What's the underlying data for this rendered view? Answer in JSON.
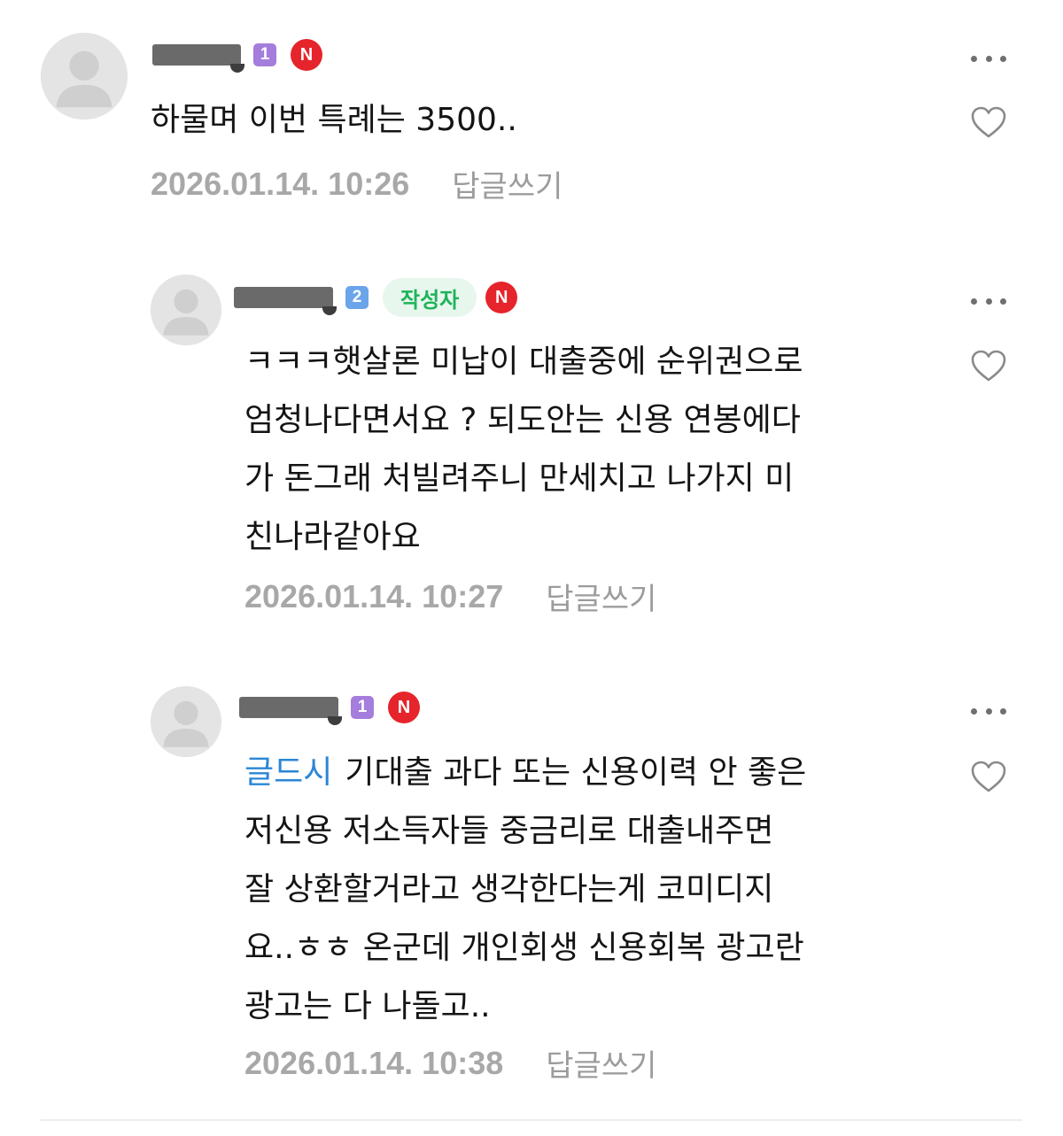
{
  "comments": [
    {
      "level": "1",
      "level_color": "#a57ddc",
      "author_badge": "",
      "n_badge": "N",
      "mention": "",
      "text": "하물며 이번 특례는 3500..",
      "date": "2026.01.14. 10:26",
      "reply_label": "답글쓰기"
    },
    {
      "level": "2",
      "level_color": "#6aa5ea",
      "author_badge": "작성자",
      "n_badge": "N",
      "mention": "",
      "text_lines": [
        "ㅋㅋㅋ햇살론 미납이 대출중에 순위권으로",
        "엄청나다면서요 ? 되도안는 신용 연봉에다",
        "가 돈그래 처빌려주니 만세치고 나가지 미",
        "친나라같아요"
      ],
      "date": "2026.01.14. 10:27",
      "reply_label": "답글쓰기"
    },
    {
      "level": "1",
      "level_color": "#a57ddc",
      "author_badge": "",
      "n_badge": "N",
      "mention": "글드시",
      "text_lines": [
        "기대출 과다 또는 신용이력 안 좋은",
        "저신용 저소득자들 중금리로 대출내주면",
        "잘 상환할거라고 생각한다는게 코미디지",
        "요..ㅎㅎ 온군데 개인회생 신용회복 광고란",
        "광고는 다 나돌고.."
      ],
      "date": "2026.01.14. 10:38",
      "reply_label": "답글쓰기"
    }
  ],
  "colors": {
    "n_badge": "#e6242b",
    "author_badge_text": "#1fb35a",
    "author_badge_bg": "#e8f7ee",
    "mention": "#2a86d6",
    "meta_text": "#a8a8a8"
  },
  "icons": {
    "avatar": "default-user-avatar",
    "more": "more-dots-icon",
    "like": "heart-outline-icon"
  }
}
